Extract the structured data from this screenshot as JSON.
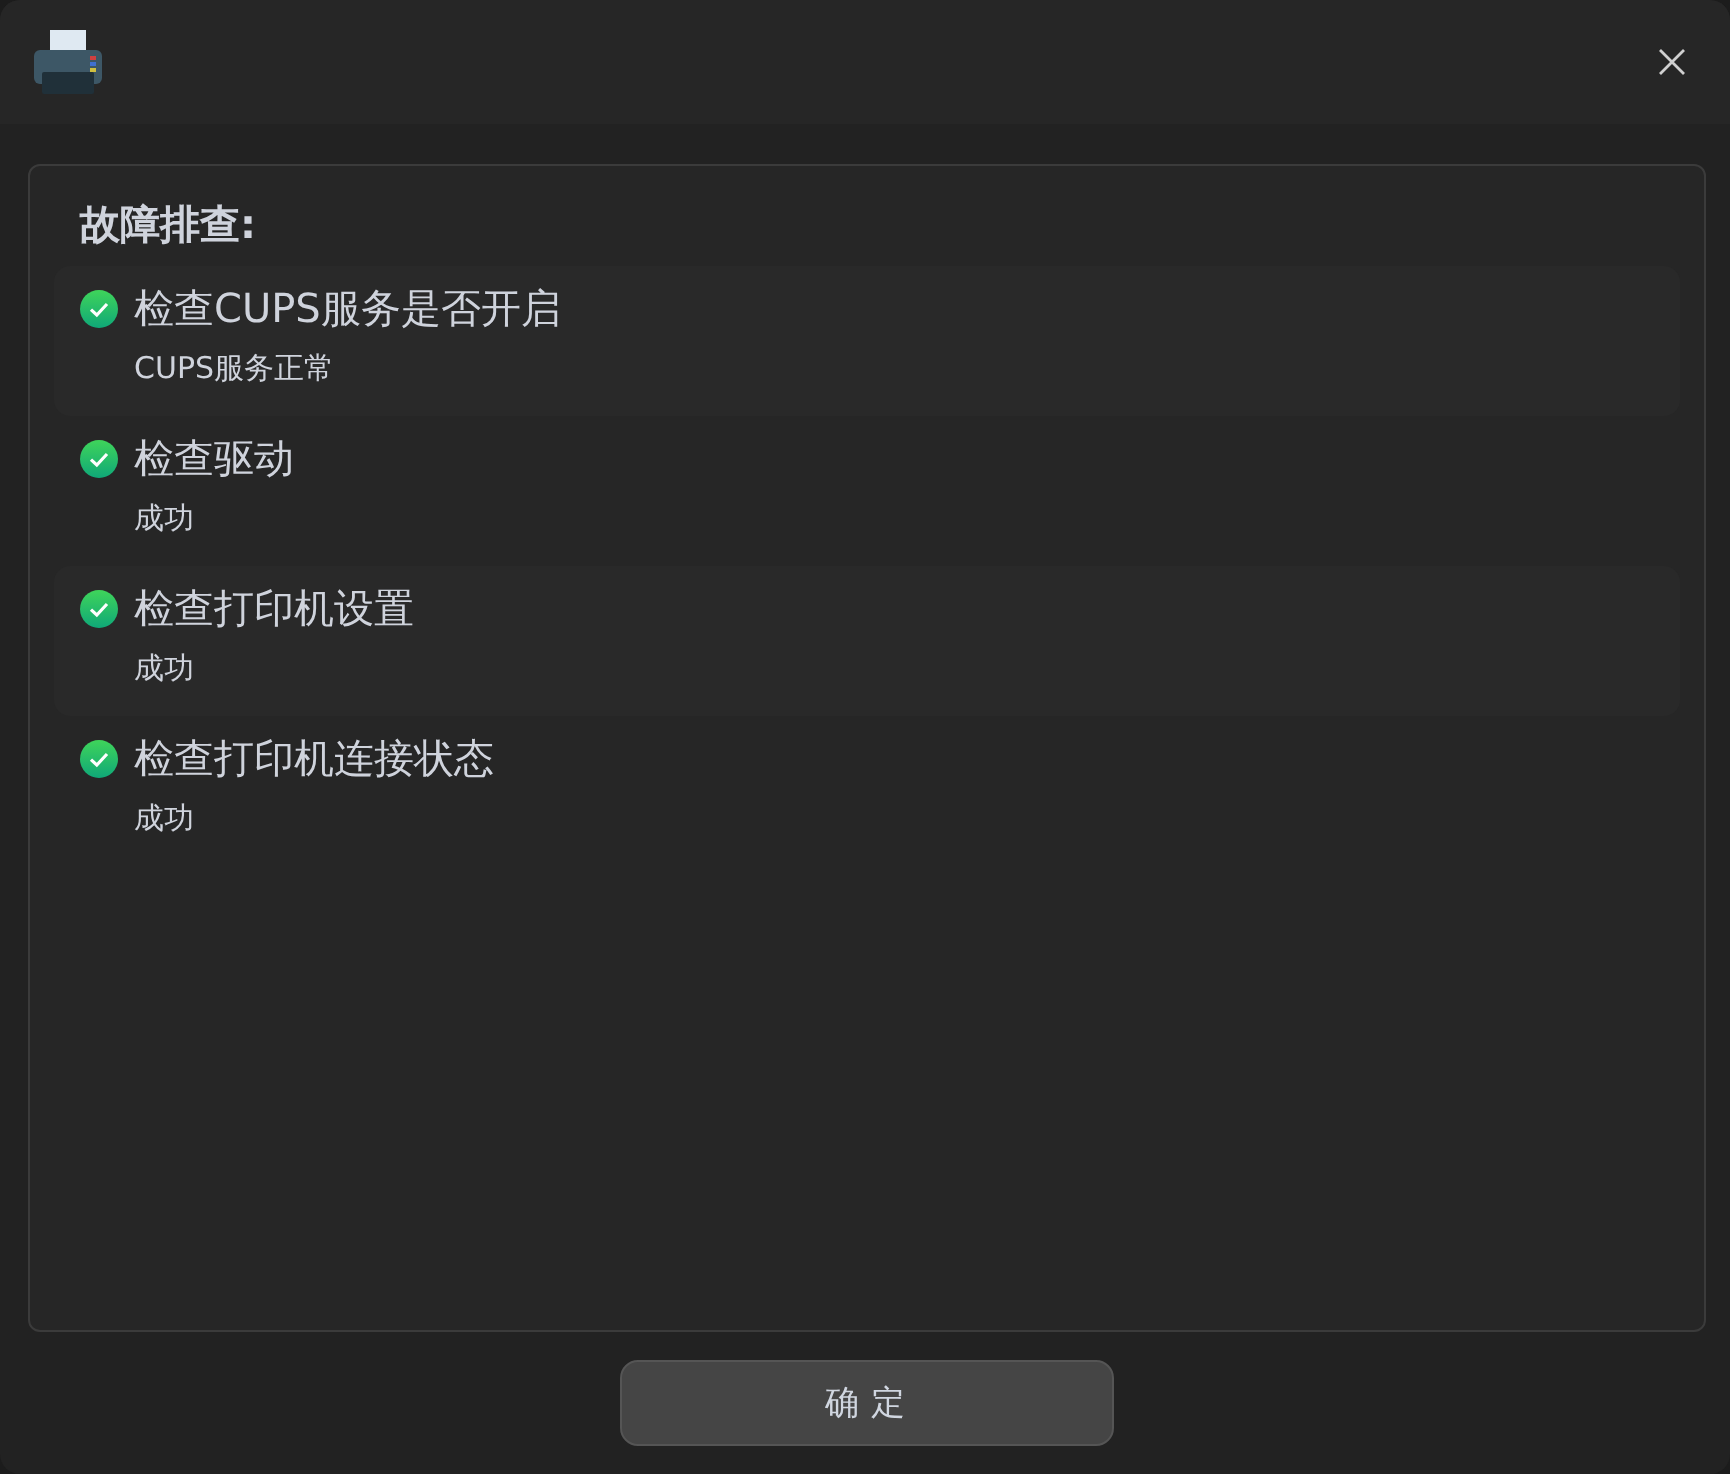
{
  "heading": "故障排查:",
  "checks": [
    {
      "title": "检查CUPS服务是否开启",
      "result": "CUPS服务正常",
      "passed": true
    },
    {
      "title": "检查驱动",
      "result": "成功",
      "passed": true
    },
    {
      "title": "检查打印机设置",
      "result": "成功",
      "passed": true
    },
    {
      "title": "检查打印机连接状态",
      "result": "成功",
      "passed": true
    }
  ],
  "button": "确定"
}
